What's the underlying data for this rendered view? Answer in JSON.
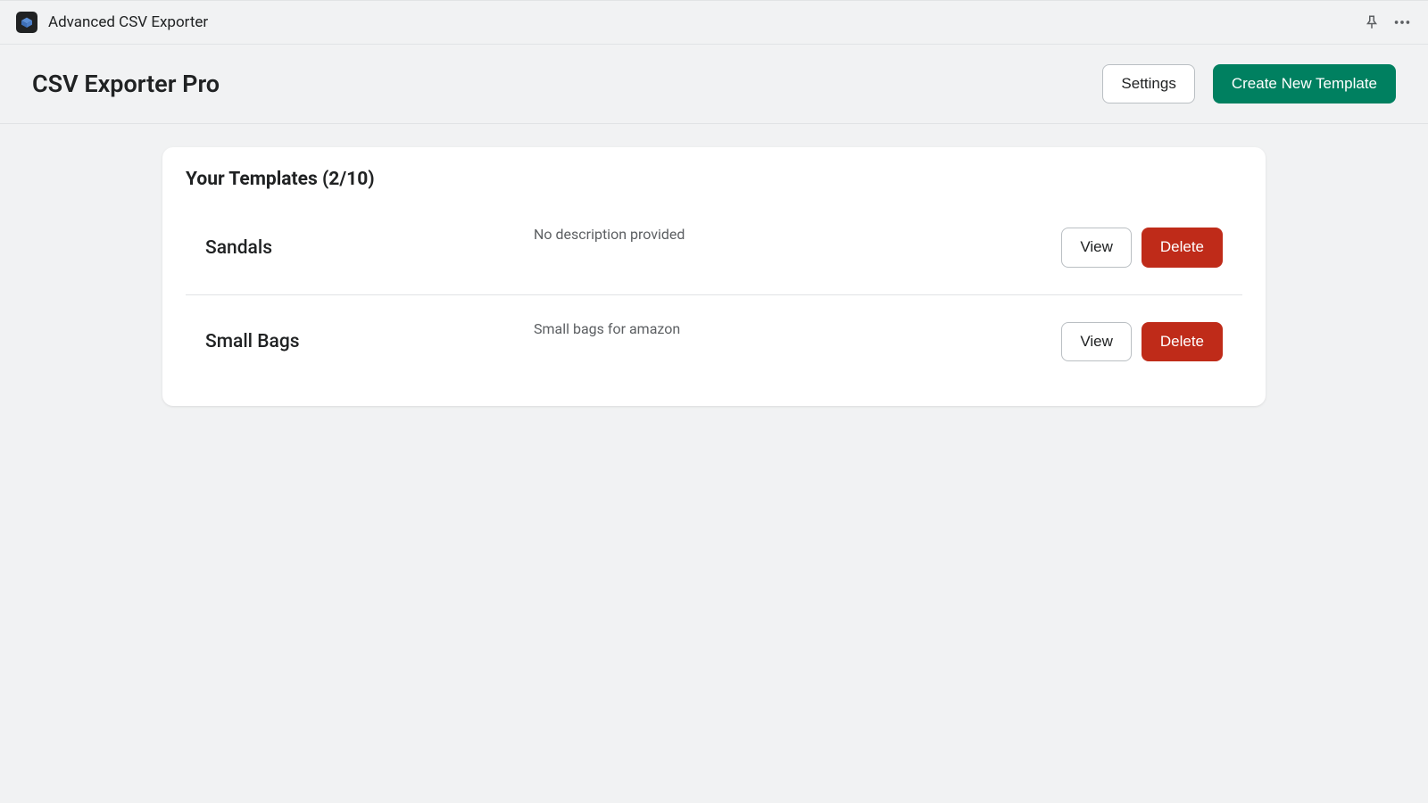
{
  "topbar": {
    "app_name": "Advanced CSV Exporter"
  },
  "header": {
    "title": "CSV Exporter Pro",
    "settings_label": "Settings",
    "create_label": "Create New Template"
  },
  "card": {
    "title": "Your Templates (2/10)",
    "templates": [
      {
        "name": "Sandals",
        "description": "No description provided",
        "view_label": "View",
        "delete_label": "Delete"
      },
      {
        "name": "Small Bags",
        "description": "Small bags for amazon",
        "view_label": "View",
        "delete_label": "Delete"
      }
    ]
  }
}
